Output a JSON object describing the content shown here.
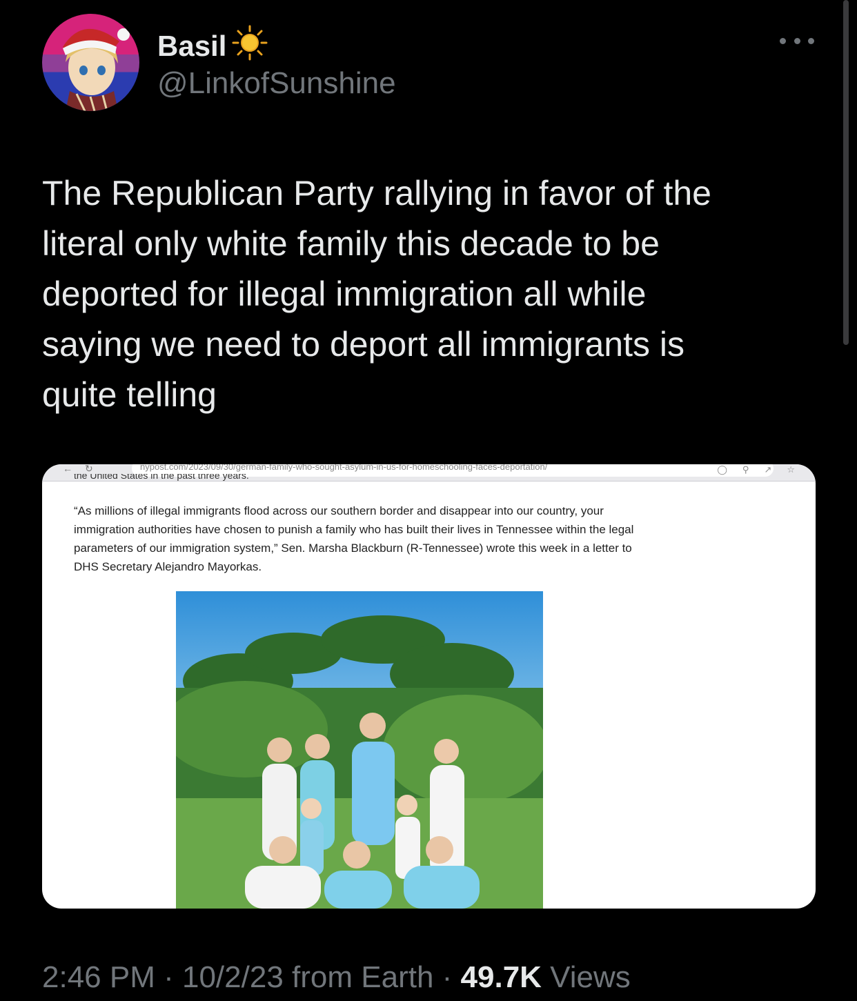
{
  "author": {
    "display_name": "Basil",
    "name_emoji": "sun-emoji",
    "handle": "@LinkofSunshine"
  },
  "tweet": {
    "text": "The Republican Party rallying in favor of the\nliteral only white family this decade to be\ndeported for illegal immigration all while\nsaying we need to deport all immigrants is\nquite telling"
  },
  "media": {
    "url": "nypost.com/2023/09/30/german-family-who-sought-asylum-in-us-for-homeschooling-faces-deportation/",
    "cut_line": "the United States in the past three years.",
    "quote": "“As millions of illegal immigrants flood across our southern border and disappear into our country, your immigration authorities have chosen to punish a family who has built their lives in Tennessee within the legal parameters of our immigration system,” Sen. Marsha Blackburn (R-Tennessee) wrote this week in a letter to DHS Secretary Alejandro Mayorkas."
  },
  "meta": {
    "time": "2:46 PM",
    "sep1": " · ",
    "date": "10/2/23",
    "source": " from Earth",
    "sep2": " · ",
    "views_count": "49.7K",
    "views_label": " Views"
  },
  "colors": {
    "background": "#000000",
    "text_primary": "#e7e9ea",
    "text_secondary": "#71767b"
  }
}
